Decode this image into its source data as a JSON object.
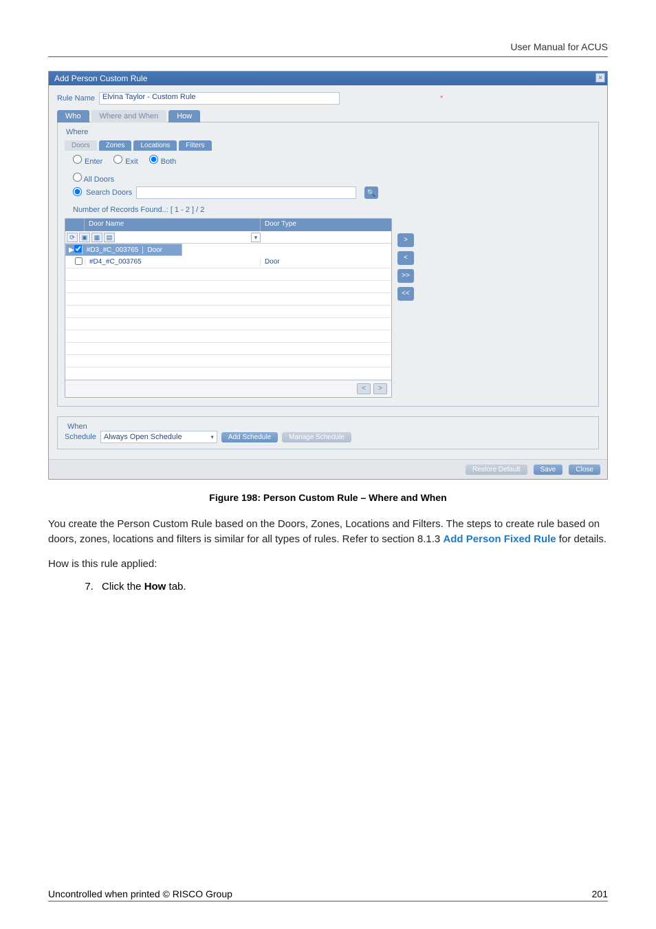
{
  "header": {
    "title": "User Manual for ACUS"
  },
  "dialog": {
    "title": "Add Person Custom Rule",
    "rule_name_label": "Rule Name",
    "rule_name_value": "Elvina Taylor - Custom Rule",
    "main_tabs": {
      "who": "Who",
      "where_when": "Where and When",
      "how": "How"
    },
    "where_group": "Where",
    "sub_tabs": {
      "doors": "Doors",
      "zones": "Zones",
      "locations": "Locations",
      "filters": "Filters"
    },
    "radios": {
      "enter": "Enter",
      "exit": "Exit",
      "both": "Both"
    },
    "all_doors": "All Doors",
    "search_doors": "Search Doors",
    "records_found": "Number of Records Found..: [ 1 - 2 ] / 2",
    "grid_headers": {
      "name": "Door Name",
      "type": "Door Type"
    },
    "rows": [
      {
        "name": "#D3_#C_003765",
        "type": "Door",
        "selected": true
      },
      {
        "name": "#D4_#C_003765",
        "type": "Door",
        "selected": false
      }
    ],
    "move": {
      "r1": ">",
      "r2": "<",
      "r3": ">>",
      "r4": "<<"
    },
    "pager": {
      "prev": "<",
      "next": ">"
    },
    "when_group": "When",
    "schedule_label": "Schedule",
    "schedule_value": "Always Open Schedule",
    "btn_add_sched": "Add Schedule",
    "btn_manage_sched": "Manage Schedule",
    "footer": {
      "restore": "Restore Default",
      "save": "Save",
      "close": "Close"
    }
  },
  "caption": "Figure 198: Person Custom Rule – Where and When",
  "para1_a": "You create the Person Custom Rule based on the Doors, Zones, Locations and Filters. The steps to create rule based on doors, zones, locations and filters is similar for all types of rules. Refer to section 8.1.3 ",
  "para1_link": "Add Person Fixed Rule",
  "para1_b": " for details.",
  "para2": "How is this rule applied:",
  "step7_a": "Click the ",
  "step7_b": "How",
  "step7_c": " tab.",
  "footer": {
    "left": "Uncontrolled when printed © RISCO Group",
    "right": "201"
  }
}
